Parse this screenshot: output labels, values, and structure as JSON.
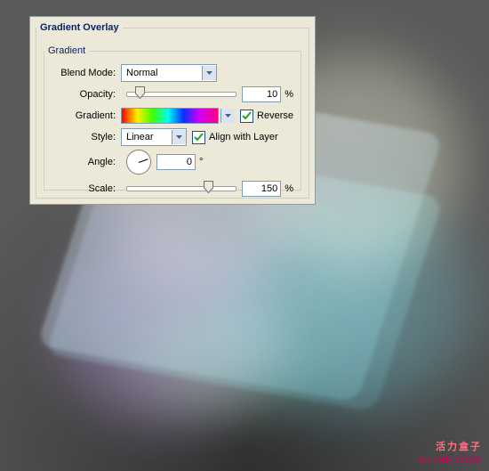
{
  "section_title": "Gradient Overlay",
  "gradient_group_title": "Gradient",
  "rows": {
    "blend_mode": {
      "label": "Blend Mode:",
      "value": "Normal"
    },
    "opacity": {
      "label": "Opacity:",
      "value": "10",
      "unit": "%",
      "slider_pos_pct": 7
    },
    "gradient": {
      "label": "Gradient:"
    },
    "reverse": {
      "label": "Reverse",
      "checked": true
    },
    "style": {
      "label": "Style:",
      "value": "Linear"
    },
    "align": {
      "label": "Align with Layer",
      "checked": true
    },
    "angle": {
      "label": "Angle:",
      "value": "0",
      "unit": "°",
      "dial_deg": -20
    },
    "scale": {
      "label": "Scale:",
      "value": "150",
      "unit": "%",
      "slider_pos_pct": 70
    }
  },
  "icons": {
    "chevron_down": "chevron-down-icon",
    "check": "check-icon"
  },
  "watermark": {
    "line1": "活力盒子",
    "line2": "OLIHE.COM"
  }
}
